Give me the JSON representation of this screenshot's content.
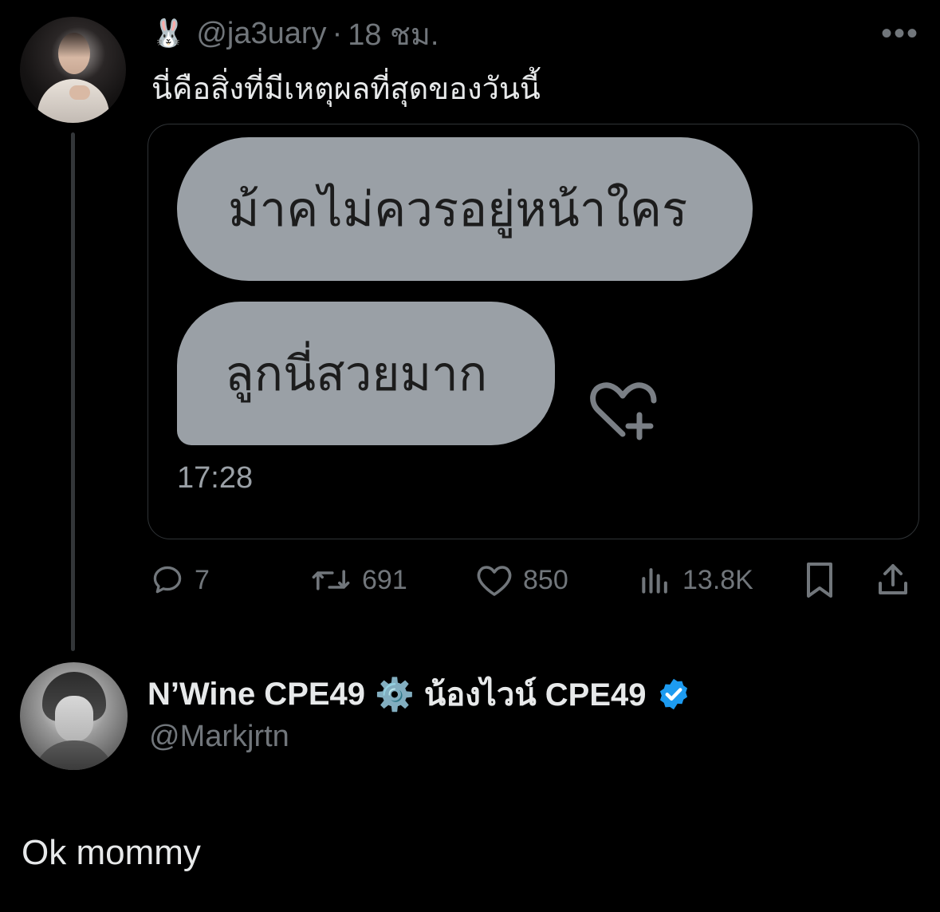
{
  "tweet": {
    "handle": "@ja3uary",
    "separator": "·",
    "time": "18 ชม.",
    "bunny_emoji": "🐰",
    "more_label": "•••",
    "text": "นี่คือสิ่งที่มีเหตุผลที่สุดของวันนี้",
    "media": {
      "bubble1": "ม้าคไม่ควรอยู่หน้าใคร",
      "bubble2": "ลูกนี่สวยมาก",
      "timestamp": "17:28",
      "react_icon": "heart-plus-icon"
    },
    "actions": {
      "replies": "7",
      "retweets": "691",
      "likes": "850",
      "views": "13.8K"
    }
  },
  "reply": {
    "name_part1": "N’Wine CPE49",
    "gear_emoji": "⚙️",
    "name_part2": "น้องไวน์ CPE49",
    "handle": "@Markjrtn",
    "text": "Ok mommy",
    "verified_color": "#1d9bf0"
  },
  "colors": {
    "background": "#000000",
    "primary_text": "#e7e9ea",
    "secondary_text": "#71767b",
    "bubble": "#9aa0a6",
    "thread_line": "#333639"
  }
}
